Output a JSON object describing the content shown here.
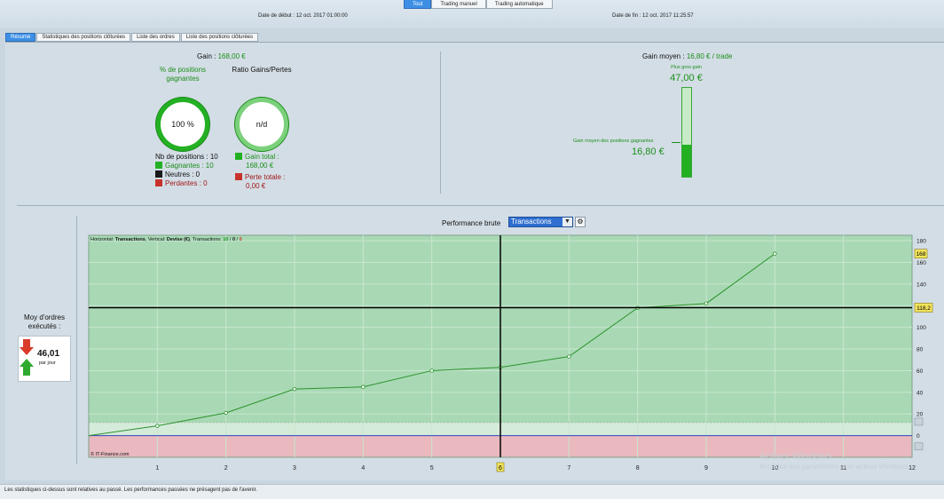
{
  "mode_tabs": [
    {
      "label": "Tout",
      "active": true
    },
    {
      "label": "Trading manuel",
      "active": false
    },
    {
      "label": "Trading automatique",
      "active": false
    }
  ],
  "dates": {
    "start": "Date de début : 12 oct. 2017 01:00:00",
    "end": "Date de fin : 12 oct. 2017 11:25:57"
  },
  "sub_tabs": [
    {
      "label": "Résumé",
      "active": true
    },
    {
      "label": "Statistiques des positions clôturées",
      "active": false
    },
    {
      "label": "Liste des ordres",
      "active": false
    },
    {
      "label": "Liste des positions clôturées",
      "active": false
    }
  ],
  "summary": {
    "gain_label": "Gain :",
    "gain_value": "168,00 €",
    "pct_label": "% de positions gagnantes",
    "pct_value": "100 %",
    "ratio_label": "Ratio Gains/Pertes",
    "ratio_value": "n/d",
    "nb_positions": "Nb de positions : 10",
    "gagnantes": "Gagnantes : 10",
    "neutres": "Neutres : 0",
    "perdantes": "Perdantes : 0",
    "gain_total_label": "Gain total :",
    "gain_total_value": "168,00 €",
    "perte_totale_label": "Perte totale :",
    "perte_totale_value": "0,00 €"
  },
  "gain_moyen": {
    "label": "Gain moyen :",
    "value": "16,80 € / trade",
    "plus_gros_label": "Plus gros gain",
    "plus_gros_value": "47,00 €",
    "avg_label": "Gain moyen des positions gagnantes",
    "avg_value": "16,80 €",
    "fill_fraction": 0.357
  },
  "left_box": {
    "title": "Moy d'ordres exécutés :",
    "value": "46,01",
    "unit": "par jour"
  },
  "chart_header": {
    "label": "Performance brute",
    "dropdown": "Transactions"
  },
  "chart_data": {
    "type": "line",
    "info_prefix": "Horizontal:",
    "info_h": "Transactions",
    "info_v_prefix": ", Vertical:",
    "info_v": "Devise (€)",
    "info_t_prefix": ", Transactions:",
    "info_t_win": "10",
    "info_t_sep1": " / ",
    "info_t_neutral": "0",
    "info_t_sep2": " / ",
    "info_t_loss": "0",
    "copyright": "© IT-Finance.com",
    "x": [
      0,
      1,
      2,
      3,
      4,
      5,
      6,
      7,
      8,
      9,
      10
    ],
    "y": [
      0,
      9,
      21,
      43,
      45,
      60,
      63,
      73,
      118,
      122,
      168
    ],
    "xlim": [
      0,
      12
    ],
    "ylim": [
      -20,
      185
    ],
    "xticks": [
      "1",
      "2",
      "3",
      "4",
      "5",
      "6",
      "7",
      "8",
      "9",
      "10",
      "11",
      "12"
    ],
    "yticks": [
      "180",
      "160",
      "140",
      "120",
      "100",
      "80",
      "60",
      "40",
      "20",
      "0"
    ],
    "last_value_label": "168",
    "crosshair_x_label": "6",
    "crosshair_y_label": "118,2",
    "crosshair_x": 6.0,
    "crosshair_y": 118.2,
    "grid": true,
    "colors": {
      "profit_zone": "#a8d9b4",
      "loss_zone": "#e9b9bf",
      "line": "#2c922c"
    }
  },
  "footer": "Les statistiques ci-dessus sont relatives au passé. Les performances passées ne présagent pas de l'avenir.",
  "watermark": {
    "line1": "Activer Windows",
    "line2": "Accédez aux paramètres pour activer Windows."
  }
}
